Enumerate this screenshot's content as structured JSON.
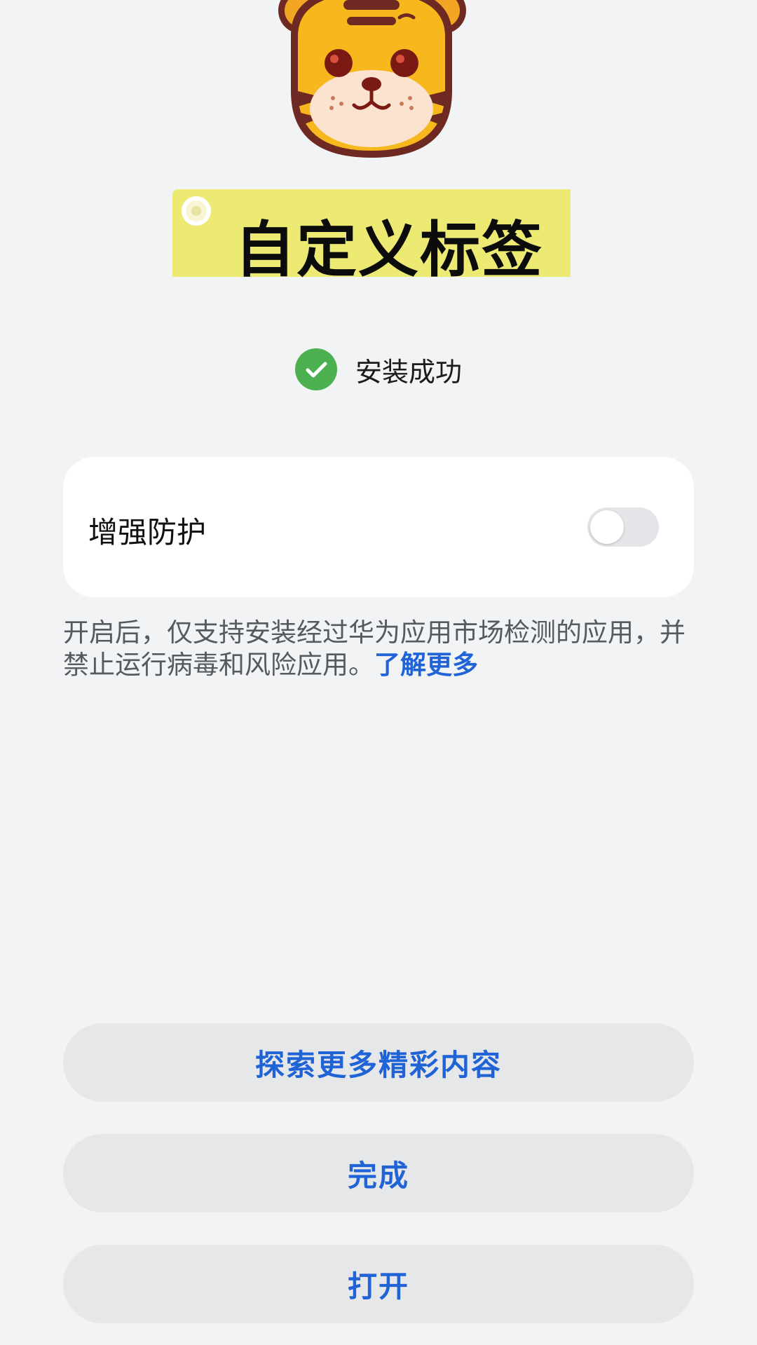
{
  "title_tag": {
    "label": "自定义标签"
  },
  "status": {
    "text": "安装成功",
    "icon": "check-circle-icon"
  },
  "enhanced_protection": {
    "label": "增强防护",
    "toggle_on": false
  },
  "description": {
    "text": "开启后，仅支持安装经过华为应用市场检测的应用，并禁止运行病毒和风险应用。",
    "link_text": "了解更多"
  },
  "buttons": {
    "explore": "探索更多精彩内容",
    "done": "完成",
    "open": "打开"
  },
  "colors": {
    "accent": "#1f63d6",
    "success": "#4caf50",
    "tag_yellow": "#ecea73",
    "background": "#f1f3f5"
  }
}
